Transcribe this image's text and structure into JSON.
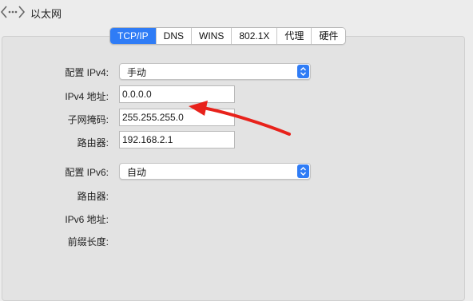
{
  "window": {
    "title": "以太网"
  },
  "tabs": [
    {
      "label": "TCP/IP",
      "active": true
    },
    {
      "label": "DNS",
      "active": false
    },
    {
      "label": "WINS",
      "active": false
    },
    {
      "label": "802.1X",
      "active": false
    },
    {
      "label": "代理",
      "active": false
    },
    {
      "label": "硬件",
      "active": false
    }
  ],
  "ipv4": {
    "config_label": "配置 IPv4:",
    "config_value": "手动",
    "address_label": "IPv4 地址:",
    "address_value": "0.0.0.0",
    "subnet_label": "子网掩码:",
    "subnet_value": "255.255.255.0",
    "router_label": "路由器:",
    "router_value": "192.168.2.1"
  },
  "ipv6": {
    "config_label": "配置 IPv6:",
    "config_value": "自动",
    "router_label": "路由器:",
    "address_label": "IPv6 地址:",
    "prefix_label": "前缀长度:"
  },
  "colors": {
    "accent": "#2f7cf6",
    "annotation_arrow": "#e8221b"
  },
  "icons": {
    "nav": "back-forward-icon",
    "popup": "up-down-stepper-icon"
  }
}
